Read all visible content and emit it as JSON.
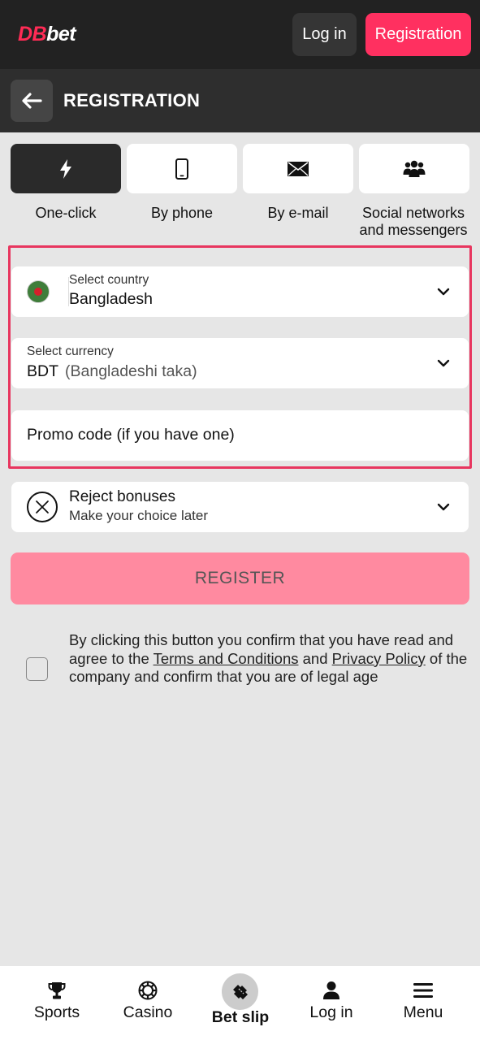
{
  "header": {
    "logo_part1": "DB",
    "logo_part2": "bet",
    "login_label": "Log in",
    "registration_label": "Registration"
  },
  "titlebar": {
    "title": "REGISTRATION",
    "back_icon": "arrow-left-icon"
  },
  "methods": [
    {
      "label": "One-click",
      "icon": "lightning-icon",
      "active": true
    },
    {
      "label": "By phone",
      "icon": "phone-icon",
      "active": false
    },
    {
      "label": "By e-mail",
      "icon": "envelope-icon",
      "active": false
    },
    {
      "label_line1": "Social networks",
      "label_line2": "and messengers",
      "icon": "users-icon",
      "active": false
    }
  ],
  "form": {
    "country": {
      "label": "Select country",
      "value": "Bangladesh",
      "flag": "bangladesh-flag-icon"
    },
    "currency": {
      "label": "Select currency",
      "code": "BDT",
      "name": "(Bangladeshi taka)"
    },
    "promo": {
      "placeholder": "Promo code (if you have one)"
    },
    "bonus": {
      "title": "Reject bonuses",
      "subtitle": "Make your choice later",
      "icon": "x-circle-icon"
    }
  },
  "register_label": "REGISTER",
  "consent": {
    "text_before": "By clicking this button you confirm that you have read and agree to the ",
    "terms_link": "Terms and Conditions",
    "text_and": " and ",
    "privacy_link": "Privacy Policy",
    "text_after": " of the company and confirm that you are of legal age",
    "checked": false
  },
  "bottom_nav": [
    {
      "label": "Sports",
      "icon": "trophy-icon"
    },
    {
      "label": "Casino",
      "icon": "casino-chip-icon"
    },
    {
      "label": "Bet slip",
      "icon": "ticket-icon"
    },
    {
      "label": "Log in",
      "icon": "user-icon"
    },
    {
      "label": "Menu",
      "icon": "hamburger-icon"
    }
  ],
  "colors": {
    "accent": "#ff3060",
    "highlight_frame": "#e8365f",
    "register_button": "#ff8aa0",
    "header_bg": "#222222"
  }
}
